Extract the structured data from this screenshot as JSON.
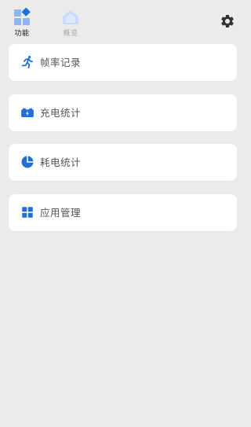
{
  "colors": {
    "background": "#ebebeb",
    "card": "#ffffff",
    "accent": "#1e6fd9",
    "label": "#555555",
    "tab_active": "#1a1a1a",
    "tab_inactive": "#a8a8a8"
  },
  "tabs": [
    {
      "label": "功能",
      "icon": "grid-diamond-icon",
      "active": true
    },
    {
      "label": "概览",
      "icon": "home-icon",
      "active": false
    }
  ],
  "settings": {
    "icon": "gear-icon"
  },
  "menu": [
    {
      "label": "帧率记录",
      "icon": "running-person-icon"
    },
    {
      "label": "充电统计",
      "icon": "battery-charging-icon"
    },
    {
      "label": "耗电统计",
      "icon": "pie-chart-icon"
    },
    {
      "label": "应用管理",
      "icon": "app-grid-icon"
    }
  ]
}
